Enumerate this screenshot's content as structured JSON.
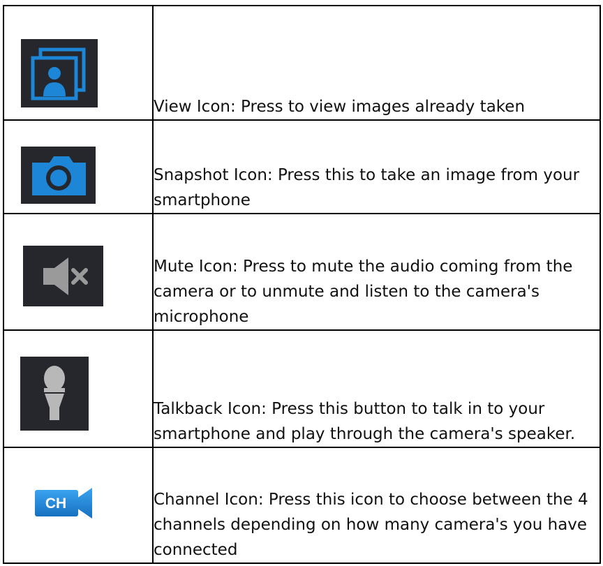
{
  "rows": [
    {
      "icon": "gallery-icon",
      "text": "View Icon: Press to view images already taken"
    },
    {
      "icon": "camera-icon",
      "text": "Snapshot Icon: Press this to take an image from your smartphone"
    },
    {
      "icon": "speaker-mute-icon",
      "text": "Mute Icon: Press to mute the audio coming from the camera or to unmute and listen to the camera's microphone"
    },
    {
      "icon": "microphone-icon",
      "text": "Talkback Icon: Press this button to talk in to your smartphone and play through the camera's speaker."
    },
    {
      "icon": "channel-camera-icon",
      "icon_text": "CH",
      "text": "Channel Icon: Press this icon to choose between the 4 channels depending on how many camera's you have connected"
    }
  ],
  "colors": {
    "icon_bg": "#25272d",
    "accent_blue": "#1d86d6",
    "mute_gray": "#9a9a9a",
    "mic_gray": "#b8b8b8"
  }
}
